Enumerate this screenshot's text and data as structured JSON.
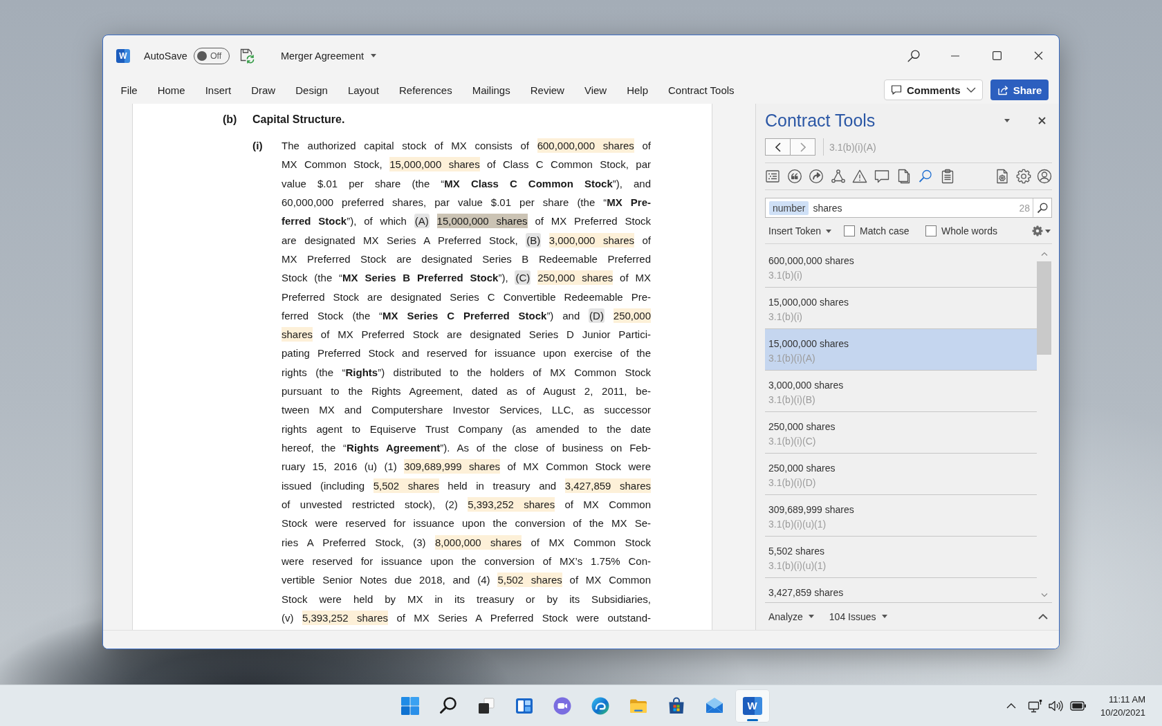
{
  "title_bar": {
    "app_letter": "W",
    "autosave_label": "AutoSave",
    "autosave_on": false,
    "autosave_state": "Off",
    "document_title": "Merger Agreement"
  },
  "ribbon": {
    "tabs": [
      {
        "label": "File",
        "selected": false
      },
      {
        "label": "Home",
        "selected": false
      },
      {
        "label": "Insert",
        "selected": false
      },
      {
        "label": "Draw",
        "selected": false
      },
      {
        "label": "Design",
        "selected": false
      },
      {
        "label": "Layout",
        "selected": false
      },
      {
        "label": "References",
        "selected": false
      },
      {
        "label": "Mailings",
        "selected": false
      },
      {
        "label": "Review",
        "selected": false
      },
      {
        "label": "View",
        "selected": false
      },
      {
        "label": "Help",
        "selected": false
      },
      {
        "label": "Contract Tools",
        "selected": false
      }
    ],
    "comments_button": "Comments",
    "share_button": "Share"
  },
  "document": {
    "section_marker": "(b)",
    "section_heading": "Capital Structure.",
    "item_marker": "(i)",
    "lines": [
      [
        {
          "text": "The authorized capital stock of MX consists of",
          "kind": "plain"
        },
        {
          "text": "600,000,000 shares",
          "kind": "match"
        },
        {
          "text": "of",
          "kind": "plain"
        }
      ],
      [
        {
          "text": "MX Common Stock,",
          "kind": "plain"
        },
        {
          "text": "15,000,000 shares",
          "kind": "match"
        },
        {
          "text": "of Class C Common Stock, par",
          "kind": "plain"
        }
      ],
      [
        {
          "text": "value $.01 per share (the “**MX Class C Common Stock**”), and",
          "kind": "plain"
        }
      ],
      [
        {
          "text": "60,000,000 preferred shares, par value $.01 per share (the “**MX Pre-**",
          "kind": "plain"
        }
      ],
      [
        {
          "text": "**ferred Stock**”), of which",
          "kind": "plain"
        },
        {
          "text": "(A)",
          "kind": "label"
        },
        {
          "text": "15,000,000 shares",
          "kind": "current"
        },
        {
          "text": "of MX Preferred Stock",
          "kind": "plain"
        }
      ],
      [
        {
          "text": "are designated MX Series A Preferred Stock,",
          "kind": "plain"
        },
        {
          "text": "(B)",
          "kind": "label"
        },
        {
          "text": "3,000,000 shares",
          "kind": "match"
        },
        {
          "text": "of",
          "kind": "plain"
        }
      ],
      [
        {
          "text": "MX Preferred Stock are designated Series B Redeemable Preferred",
          "kind": "plain"
        }
      ],
      [
        {
          "text": "Stock (the “**MX Series B Preferred Stock**”),",
          "kind": "plain"
        },
        {
          "text": "(C)",
          "kind": "label"
        },
        {
          "text": "250,000 shares",
          "kind": "match"
        },
        {
          "text": "of MX",
          "kind": "plain"
        }
      ],
      [
        {
          "text": "Preferred Stock are designated Series C Convertible Redeemable Pre-",
          "kind": "plain"
        }
      ],
      [
        {
          "text": "ferred Stock (the “**MX Series C Preferred Stock**”) and",
          "kind": "plain"
        },
        {
          "text": "(D)",
          "kind": "label"
        },
        {
          "text": "250,000",
          "kind": "match"
        }
      ],
      [
        {
          "text": "shares",
          "kind": "match"
        },
        {
          "text": "of MX Preferred Stock are designated Series D Junior Partici-",
          "kind": "plain"
        }
      ],
      [
        {
          "text": "pating Preferred Stock and reserved for issuance upon exercise of the",
          "kind": "plain"
        }
      ],
      [
        {
          "text": "rights (the “**Rights**”) distributed to the holders of MX Common Stock",
          "kind": "plain"
        }
      ],
      [
        {
          "text": "pursuant to the Rights Agreement, dated as of August 2, 2011, be-",
          "kind": "plain"
        }
      ],
      [
        {
          "text": "tween MX and Computershare Investor Services, LLC, as successor",
          "kind": "plain"
        }
      ],
      [
        {
          "text": "rights agent to Equiserve Trust Company (as amended to the date",
          "kind": "plain"
        }
      ],
      [
        {
          "text": "hereof, the “**Rights Agreement**”). As of the close of business on Feb-",
          "kind": "plain"
        }
      ],
      [
        {
          "text": "ruary 15, 2016 (u) (1)",
          "kind": "plain"
        },
        {
          "text": "309,689,999 shares",
          "kind": "match"
        },
        {
          "text": "of MX Common Stock were",
          "kind": "plain"
        }
      ],
      [
        {
          "text": "issued (including",
          "kind": "plain"
        },
        {
          "text": "5,502 shares",
          "kind": "match"
        },
        {
          "text": "held in treasury and",
          "kind": "plain"
        },
        {
          "text": "3,427,859 shares",
          "kind": "match"
        }
      ],
      [
        {
          "text": "of unvested restricted stock), (2)",
          "kind": "plain"
        },
        {
          "text": "5,393,252 shares",
          "kind": "match"
        },
        {
          "text": "of MX Common",
          "kind": "plain"
        }
      ],
      [
        {
          "text": "Stock were reserved for issuance upon the conversion of the MX Se-",
          "kind": "plain"
        }
      ],
      [
        {
          "text": "ries A Preferred Stock, (3)",
          "kind": "plain"
        },
        {
          "text": "8,000,000 shares",
          "kind": "match"
        },
        {
          "text": "of MX Common Stock",
          "kind": "plain"
        }
      ],
      [
        {
          "text": "were reserved for issuance upon the conversion of MX’s 1.75% Con-",
          "kind": "plain"
        }
      ],
      [
        {
          "text": "vertible Senior Notes due 2018, and (4)",
          "kind": "plain"
        },
        {
          "text": "5,502 shares",
          "kind": "match"
        },
        {
          "text": "of MX Common",
          "kind": "plain"
        }
      ],
      [
        {
          "text": "Stock were held by MX in its treasury or by its Subsidiaries,",
          "kind": "plain"
        }
      ],
      [
        {
          "text": "(v)",
          "kind": "plain"
        },
        {
          "text": "5,393,252 shares",
          "kind": "match"
        },
        {
          "text": "of MX Series A Preferred Stock were outstand-",
          "kind": "plain"
        }
      ]
    ]
  },
  "task_pane": {
    "title": "Contract Tools",
    "navigation": {
      "back_disabled": false,
      "forward_disabled": true
    },
    "location": "3.1(b)(i)(A)",
    "tools": [
      {
        "selected": false
      },
      {
        "selected": false
      },
      {
        "selected": false
      },
      {
        "selected": false
      },
      {
        "selected": false
      },
      {
        "selected": false
      },
      {
        "selected": false
      },
      {
        "selected": true
      },
      {
        "selected": false
      },
      {
        "selected": false
      },
      {
        "selected": false
      },
      {
        "selected": false
      }
    ],
    "search": {
      "token": "number",
      "query": "shares",
      "count": "28"
    },
    "insert_token": "Insert Token",
    "options": [
      {
        "label": "Match case",
        "checked": false
      },
      {
        "label": "Whole words",
        "checked": false
      }
    ],
    "results": [
      {
        "title": "600,000,000 shares",
        "ref": "3.1(b)(i)",
        "selected": false
      },
      {
        "title": "15,000,000 shares",
        "ref": "3.1(b)(i)",
        "selected": false
      },
      {
        "title": "15,000,000 shares",
        "ref": "3.1(b)(i)(A)",
        "selected": true
      },
      {
        "title": "3,000,000 shares",
        "ref": "3.1(b)(i)(B)",
        "selected": false
      },
      {
        "title": "250,000 shares",
        "ref": "3.1(b)(i)(C)",
        "selected": false
      },
      {
        "title": "250,000 shares",
        "ref": "3.1(b)(i)(D)",
        "selected": false
      },
      {
        "title": "309,689,999 shares",
        "ref": "3.1(b)(i)(u)(1)",
        "selected": false
      },
      {
        "title": "5,502 shares",
        "ref": "3.1(b)(i)(u)(1)",
        "selected": false
      },
      {
        "title": "3,427,859 shares",
        "selected": false
      }
    ],
    "analyze": "Analyze",
    "issues": "104 Issues"
  },
  "taskbar": {
    "apps": [
      {
        "selected": false
      },
      {
        "selected": false
      },
      {
        "selected": false
      },
      {
        "selected": false
      },
      {
        "selected": false
      },
      {
        "selected": false
      },
      {
        "selected": false
      },
      {
        "selected": false
      },
      {
        "selected": false
      },
      {
        "selected": true,
        "letter": "W"
      }
    ],
    "time": "11:11 AM",
    "date": "10/20/2021"
  }
}
